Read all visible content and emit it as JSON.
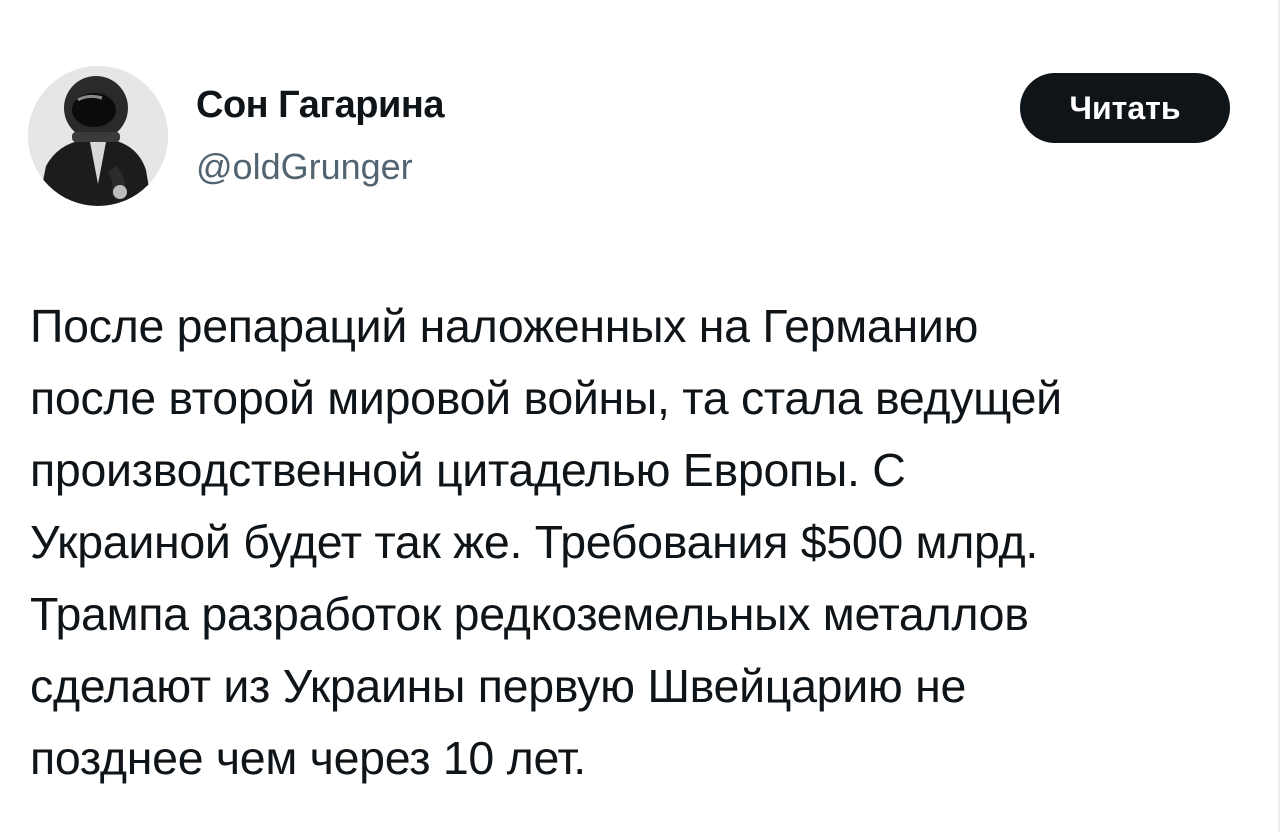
{
  "author": {
    "display_name": "Сон Гагарина",
    "handle": "@oldGrunger",
    "avatar_icon": "astronaut-avatar-icon"
  },
  "follow_button": {
    "label": "Читать"
  },
  "tweet": {
    "lines": [
      "После репараций наложенных на Германию",
      "после второй мировой войны, та стала ведущей",
      "производственной цитаделью Европы. С",
      "Украиной будет так же. Требования $500 млрд.",
      "Трампа разработок редкоземельных металлов",
      "сделают из Украины первую Швейцарию не",
      "позднее чем через 10 лет."
    ]
  },
  "colors": {
    "text_primary": "#0f1419",
    "text_secondary": "#536471",
    "button_bg": "#0f1419",
    "button_text": "#ffffff"
  }
}
